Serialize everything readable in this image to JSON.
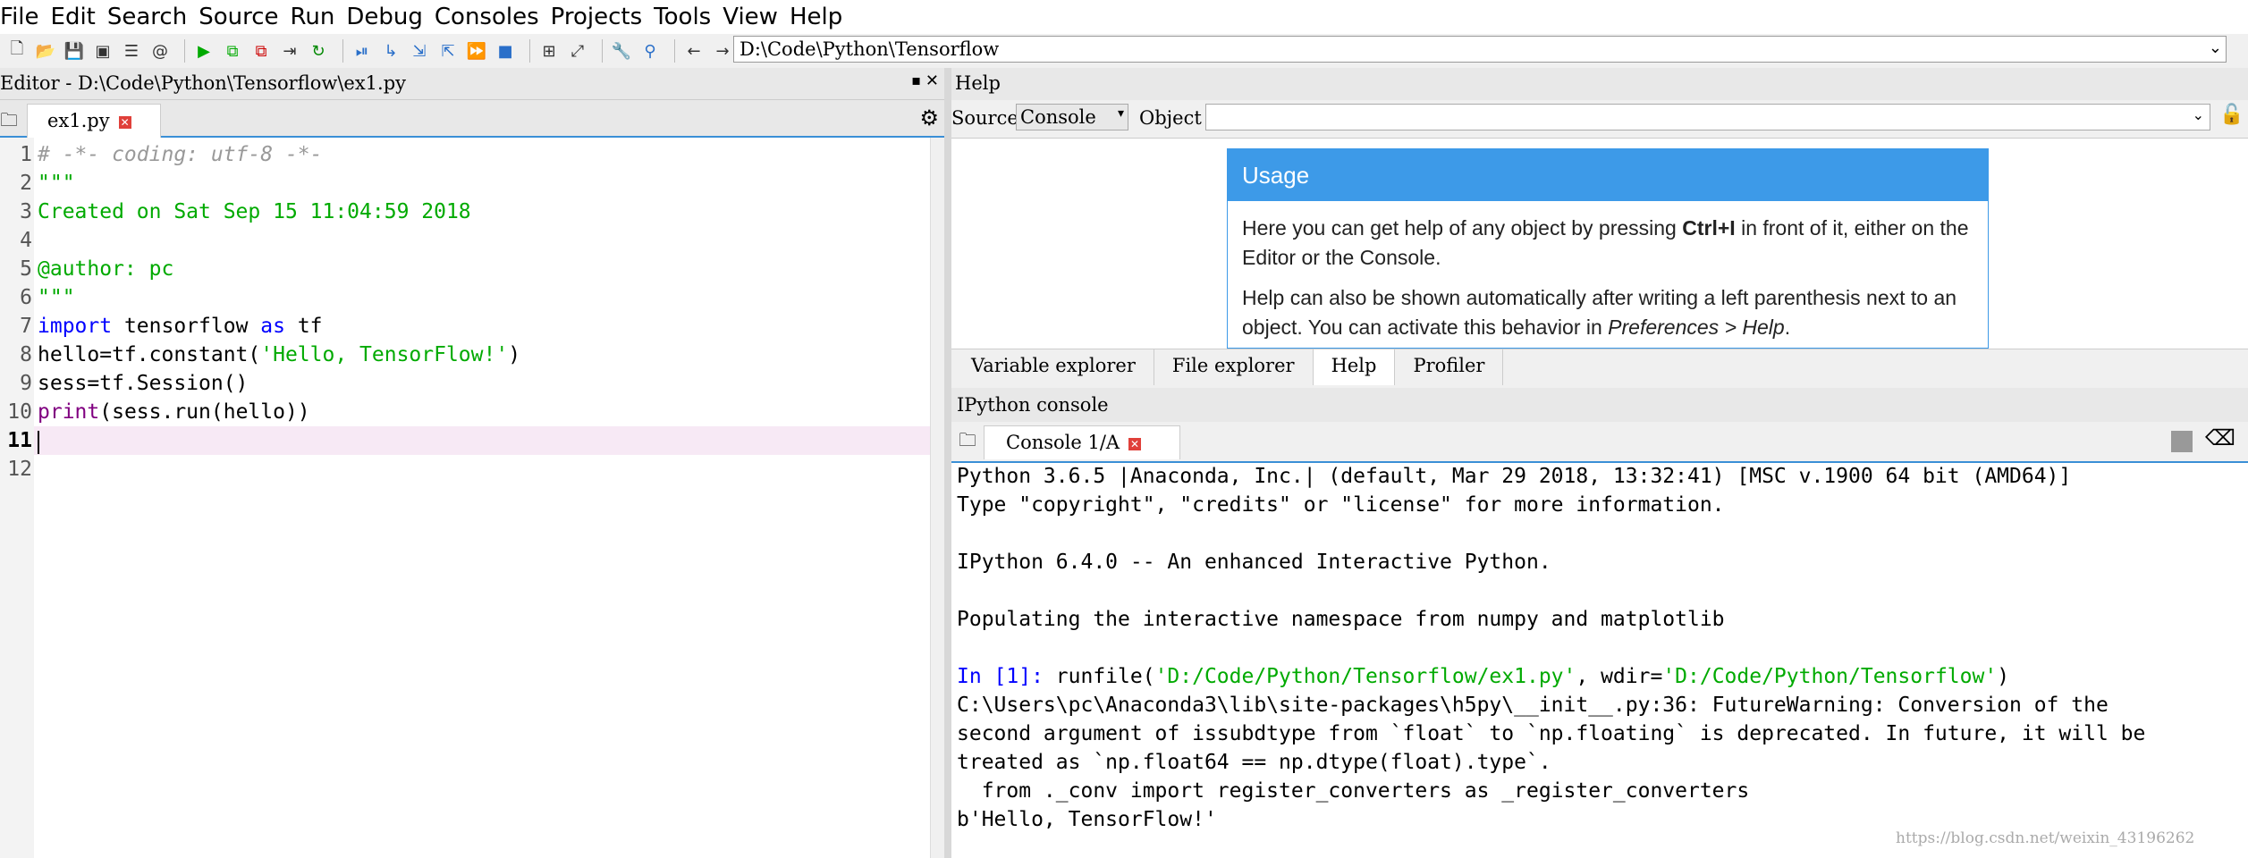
{
  "menu": [
    "File",
    "Edit",
    "Search",
    "Source",
    "Run",
    "Debug",
    "Consoles",
    "Projects",
    "Tools",
    "View",
    "Help"
  ],
  "toolbar": {
    "path": "D:\\Code\\Python\\Tensorflow"
  },
  "editor": {
    "title": "Editor - D:\\Code\\Python\\Tensorflow\\ex1.py",
    "tab": "ex1.py",
    "lines": [
      {
        "n": "1",
        "text": "# -*- coding: utf-8 -*-"
      },
      {
        "n": "2",
        "text": "\"\"\""
      },
      {
        "n": "3",
        "text": "Created on Sat Sep 15 11:04:59 2018"
      },
      {
        "n": "4",
        "text": ""
      },
      {
        "n": "5",
        "text": "@author: pc"
      },
      {
        "n": "6",
        "text": "\"\"\""
      },
      {
        "n": "7",
        "kw1": "import",
        "mid": " tensorflow ",
        "kw2": "as",
        "end": " tf"
      },
      {
        "n": "8",
        "pre": "hello=tf.constant(",
        "str": "'Hello, TensorFlow!'",
        "post": ")"
      },
      {
        "n": "9",
        "text": "sess=tf.Session()"
      },
      {
        "n": "10",
        "fn": "print",
        "rest": "(sess.run(hello))"
      },
      {
        "n": "11",
        "text": ""
      },
      {
        "n": "12",
        "text": ""
      }
    ]
  },
  "help": {
    "title": "Help",
    "source_label": "Source",
    "source_value": "Console",
    "object_label": "Object",
    "usage_title": "Usage",
    "p1a": "Here you can get help of any object by pressing ",
    "p1b": "Ctrl+I",
    "p1c": " in front of it, either on the Editor or the Console.",
    "p2a": "Help can also be shown automatically after writing a left parenthesis next to an object. You can activate this behavior in ",
    "p2b": "Preferences > Help",
    "p2c": ".",
    "tabs": [
      "Variable explorer",
      "File explorer",
      "Help",
      "Profiler"
    ]
  },
  "console": {
    "title": "IPython console",
    "tab": "Console 1/A",
    "l1": "Python 3.6.5 |Anaconda, Inc.| (default, Mar 29 2018, 13:32:41) [MSC v.1900 64 bit (AMD64)]",
    "l2": "Type \"copyright\", \"credits\" or \"license\" for more information.",
    "l3": "IPython 6.4.0 -- An enhanced Interactive Python.",
    "l4": "Populating the interactive namespace from numpy and matplotlib",
    "prompt": "In [1]:",
    "cmd1": " runfile(",
    "arg1": "'D:/Code/Python/Tensorflow/ex1.py'",
    "cmd2": ", wdir=",
    "arg2": "'D:/Code/Python/Tensorflow'",
    "cmd3": ")",
    "l6": "C:\\Users\\pc\\Anaconda3\\lib\\site-packages\\h5py\\__init__.py:36: FutureWarning: Conversion of the",
    "l7": "second argument of issubdtype from `float` to `np.floating` is deprecated. In future, it will be",
    "l8": "treated as `np.float64 == np.dtype(float).type`.",
    "l9": "  from ._conv import register_converters as _register_converters",
    "l10": "b'Hello, TensorFlow!'"
  },
  "watermark": "https://blog.csdn.net/weixin_43196262"
}
